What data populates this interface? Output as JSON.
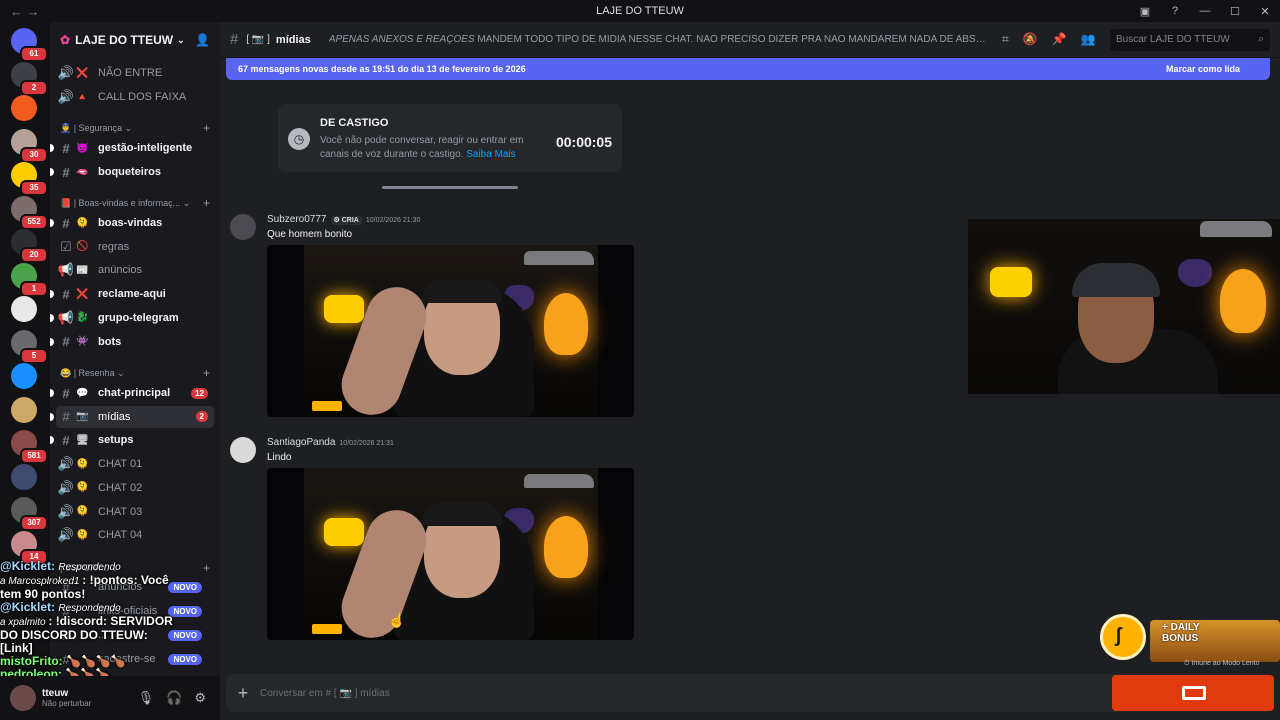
{
  "titlebar": {
    "title": "LAJE DO TTEUW",
    "nav": "← →"
  },
  "guilds": [
    {
      "color": "#5865f2",
      "badge": "61"
    },
    {
      "color": "#3d4046",
      "badge": "2"
    },
    {
      "color": "#f25c1e",
      "badge": ""
    },
    {
      "color": "#b5a09a",
      "badge": "30"
    },
    {
      "color": "#ffcc00",
      "badge": "35"
    },
    {
      "color": "#7c6c6c",
      "badge": "552"
    },
    {
      "color": "#2b2d31",
      "badge": "20"
    },
    {
      "color": "#4aa34a",
      "badge": "1"
    },
    {
      "color": "#e8e8e8",
      "badge": ""
    },
    {
      "color": "#6a6a6e",
      "badge": "5"
    },
    {
      "color": "#1a8fff",
      "badge": ""
    },
    {
      "color": "#ccaa66",
      "badge": ""
    },
    {
      "color": "#8a4a4a",
      "badge": "581"
    },
    {
      "color": "#3e4a6e",
      "badge": ""
    },
    {
      "color": "#5a5a5a",
      "badge": "307"
    },
    {
      "color": "#c88a8a",
      "badge": "14"
    }
  ],
  "server": {
    "name": "LAJE DO TTEUW"
  },
  "channels": [
    {
      "prefix": "🔊",
      "emoji": "[ ❌ ]",
      "label": "NÃO ENTRE",
      "style": ""
    },
    {
      "prefix": "🔊",
      "emoji": "[ 🔺 ]",
      "label": "CALL DOS FAIXA",
      "style": ""
    }
  ],
  "categories": {
    "seguranca": "👮 | Segurança",
    "boasvindas": "📕 | Boas-vindas e informaç...",
    "resenha": "😂 | Resenha",
    "suporte": "| SUPORT..."
  },
  "seguranca_channels": [
    {
      "prefix": "#",
      "emoji": "[ 👿 ]",
      "label": "gestão-inteligente",
      "style": "bold"
    },
    {
      "prefix": "#",
      "emoji": "[ 🫦 ]",
      "label": "boqueteiros",
      "style": "bold"
    }
  ],
  "boasvindas_channels": [
    {
      "prefix": "#",
      "emoji": "[ 🫠 ]",
      "label": "boas-vindas",
      "style": "bold"
    },
    {
      "prefix": "☑",
      "emoji": "[ 🚫 ]",
      "label": "regras",
      "style": ""
    },
    {
      "prefix": "📢",
      "emoji": "[ 📰 ]",
      "label": "anúncios",
      "style": ""
    },
    {
      "prefix": "#",
      "emoji": "[ ❌ ]",
      "label": "reclame-aqui",
      "style": "bold"
    },
    {
      "prefix": "📢",
      "emoji": "[ 🐉 ]",
      "label": "grupo-telegram",
      "style": "bold"
    },
    {
      "prefix": "#",
      "emoji": "[ 👾 ]",
      "label": "bots",
      "style": "bold"
    }
  ],
  "resenha_channels": [
    {
      "prefix": "#",
      "emoji": "[ 💬 ]",
      "label": "chat-principal",
      "style": "bold",
      "count": "12"
    },
    {
      "prefix": "#",
      "emoji": "[ 📷 ]",
      "label": "mídias",
      "style": "sel",
      "count": "2"
    },
    {
      "prefix": "#",
      "emoji": "[ 🖥 ]",
      "label": "setups",
      "style": "bold",
      "count": ""
    },
    {
      "prefix": "🔊",
      "emoji": "[ 🫠 ]",
      "label": "CHAT 01",
      "style": "",
      "count": ""
    },
    {
      "prefix": "🔊",
      "emoji": "[ 🫠 ]",
      "label": "CHAT 02",
      "style": "",
      "count": ""
    },
    {
      "prefix": "🔊",
      "emoji": "[ 🫠 ]",
      "label": "CHAT 03",
      "style": "",
      "count": ""
    },
    {
      "prefix": "🔊",
      "emoji": "[ 🫠 ]",
      "label": "CHAT 04",
      "style": "",
      "count": ""
    }
  ],
  "suporte_channels": [
    {
      "label": "anúncios",
      "novo": "NOVO"
    },
    {
      "label": "links-oficiais",
      "novo": "NOVO"
    },
    {
      "label": "...",
      "novo": "NOVO"
    },
    {
      "label": "cadastre-se",
      "novo": "NOVO"
    }
  ],
  "user": {
    "name": "tteuw",
    "status": "Não perturbar"
  },
  "overlay_chat": [
    {
      "name": "@Kicklet:",
      "rest": "Respondendo",
      "cls": "name"
    },
    {
      "pre": "a ",
      "name": "Marcosplroked1",
      "rest": ": !pontos: Você",
      "cls": "italic"
    },
    {
      "rest": "tem 90 pontos!",
      "cls": ""
    },
    {
      "name": "@Kicklet:",
      "rest": "Respondendo",
      "cls": "name"
    },
    {
      "pre": "a ",
      "name": "xpalmito",
      "rest": ": !discord: SERVIDOR",
      "cls": "italic"
    },
    {
      "rest": "DO DISCORD DO TTEUW:",
      "cls": ""
    },
    {
      "rest": "[Link]",
      "cls": ""
    },
    {
      "name": "mistoFrito:",
      "rest": "🍗🍗🍗🍗",
      "cls": "name2"
    },
    {
      "name": "pedroleop:",
      "rest": "🍗🍗🍗",
      "cls": "name2"
    },
    {
      "name": "mistoFrito:",
      "rest": "🍗🍗🍗🍗",
      "cls": "name2"
    }
  ],
  "header": {
    "channel": "mídias",
    "emoji": "[ 📷 ]",
    "topic_italic": "APENAS ANEXOS E REAÇÕES",
    "topic_rest": " MANDEM TODO TIPO DE MÍDIA NESSE CHAT. NÃO PRECISO DIZER PRA NAO MANDAREM NADA DE ABSURDO NÉ? RESPEITEM U...",
    "search_placeholder": "Buscar LAJE DO TTEUW"
  },
  "newbar": {
    "text": "67 mensagens novas desde as 19:51 do dia 13 de fevereiro de 2026",
    "mark": "Marcar como lida"
  },
  "castigo": {
    "title": "DE CASTIGO",
    "desc": "Você não pode conversar, reagir ou entrar em canais de voz durante o castigo.",
    "link": "Saiba Mais",
    "timer": "00:00:05"
  },
  "messages": [
    {
      "user": "Subzero0777",
      "tag": "CRIA",
      "time": "10/02/2026 21:30",
      "text": "Que homem bonito"
    },
    {
      "user": "SantiagoPanda",
      "tag": "",
      "time": "10/02/2026 21:31",
      "text": "Lindo"
    }
  ],
  "bonus": {
    "label1": "+ DAILY",
    "label2": "BONUS",
    "imune": "Imune ao Modo Lento"
  },
  "composer": {
    "placeholder": "Conversar em # [ 📷 ] mídias"
  }
}
